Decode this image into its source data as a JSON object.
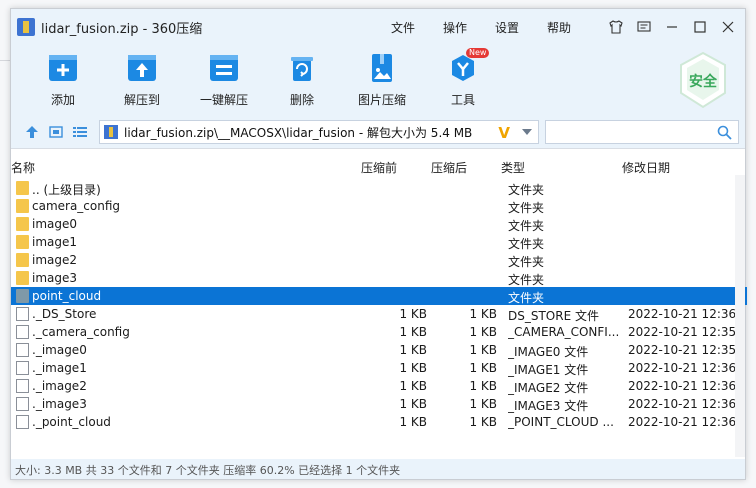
{
  "window": {
    "title": "lidar_fusion.zip - 360压缩",
    "menu": [
      "文件",
      "操作",
      "设置",
      "帮助"
    ]
  },
  "toolbar": {
    "items": [
      {
        "label": "添加",
        "icon": "add-icon"
      },
      {
        "label": "解压到",
        "icon": "extract-to-icon"
      },
      {
        "label": "一键解压",
        "icon": "one-click-extract-icon"
      },
      {
        "label": "删除",
        "icon": "trash-icon"
      },
      {
        "label": "图片压缩",
        "icon": "image-compress-icon"
      },
      {
        "label": "工具",
        "icon": "tools-icon",
        "badge": "New"
      }
    ],
    "safe_label": "安全"
  },
  "address": {
    "path": "lidar_fusion.zip\\__MACOSX\\lidar_fusion - 解包大小为 5.4 MB",
    "badge": "V",
    "search_placeholder": ""
  },
  "columns": {
    "name": "名称",
    "before": "压缩前",
    "after": "压缩后",
    "type": "类型",
    "date": "修改日期"
  },
  "rows": [
    {
      "name": ".. (上级目录)",
      "before": "",
      "after": "",
      "type": "文件夹",
      "date": "",
      "kind": "folder"
    },
    {
      "name": "camera_config",
      "before": "",
      "after": "",
      "type": "文件夹",
      "date": "",
      "kind": "folder"
    },
    {
      "name": "image0",
      "before": "",
      "after": "",
      "type": "文件夹",
      "date": "",
      "kind": "folder"
    },
    {
      "name": "image1",
      "before": "",
      "after": "",
      "type": "文件夹",
      "date": "",
      "kind": "folder"
    },
    {
      "name": "image2",
      "before": "",
      "after": "",
      "type": "文件夹",
      "date": "",
      "kind": "folder"
    },
    {
      "name": "image3",
      "before": "",
      "after": "",
      "type": "文件夹",
      "date": "",
      "kind": "folder"
    },
    {
      "name": "point_cloud",
      "before": "",
      "after": "",
      "type": "文件夹",
      "date": "",
      "kind": "folder",
      "selected": true
    },
    {
      "name": "._DS_Store",
      "before": "1 KB",
      "after": "1 KB",
      "type": "DS_STORE 文件",
      "date": "2022-10-21 12:36",
      "kind": "file"
    },
    {
      "name": "._camera_config",
      "before": "1 KB",
      "after": "1 KB",
      "type": "_CAMERA_CONFI...",
      "date": "2022-10-21 12:35",
      "kind": "file"
    },
    {
      "name": "._image0",
      "before": "1 KB",
      "after": "1 KB",
      "type": "_IMAGE0 文件",
      "date": "2022-10-21 12:35",
      "kind": "file"
    },
    {
      "name": "._image1",
      "before": "1 KB",
      "after": "1 KB",
      "type": "_IMAGE1 文件",
      "date": "2022-10-21 12:36",
      "kind": "file"
    },
    {
      "name": "._image2",
      "before": "1 KB",
      "after": "1 KB",
      "type": "_IMAGE2 文件",
      "date": "2022-10-21 12:36",
      "kind": "file"
    },
    {
      "name": "._image3",
      "before": "1 KB",
      "after": "1 KB",
      "type": "_IMAGE3 文件",
      "date": "2022-10-21 12:36",
      "kind": "file"
    },
    {
      "name": "._point_cloud",
      "before": "1 KB",
      "after": "1 KB",
      "type": "_POINT_CLOUD ...",
      "date": "2022-10-21 12:36",
      "kind": "file"
    }
  ],
  "status": "大小: 3.3 MB 共 33 个文件和 7 个文件夹 压缩率 60.2% 已经选择 1 个文件夹",
  "colors": {
    "accent": "#0b74d5",
    "toolbar_bg": "#eaf3fb",
    "folder": "#f5c64b",
    "safe": "#3aa85c"
  }
}
